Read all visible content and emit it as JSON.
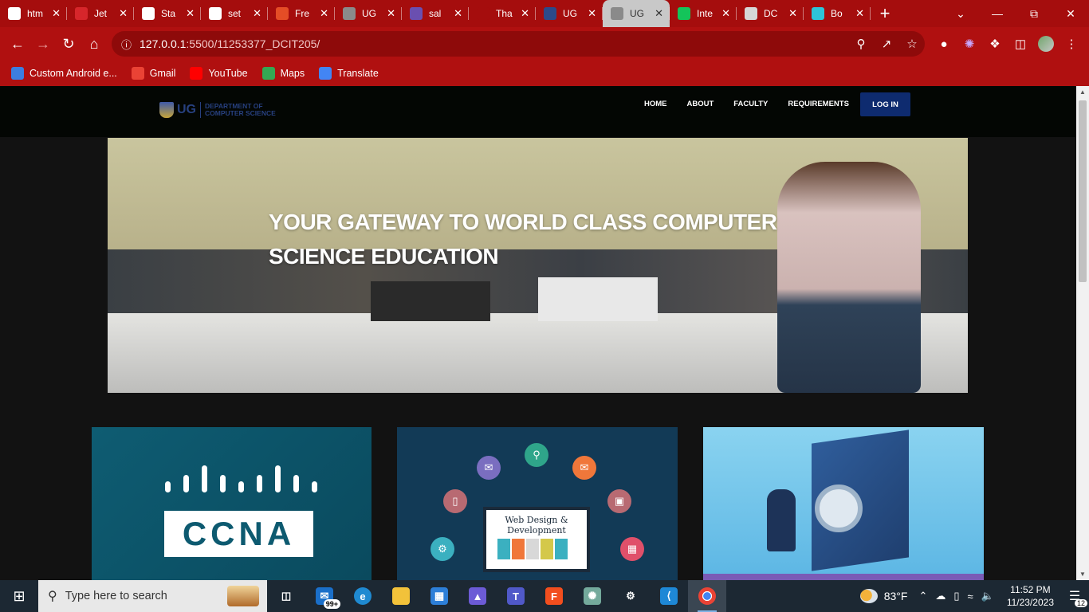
{
  "browser": {
    "tabs": [
      {
        "title": "htm",
        "favicon_color": "#ffffff",
        "icon": "google-icon"
      },
      {
        "title": "Jet",
        "favicon_color": "#d7262b",
        "icon": "swiss-icon"
      },
      {
        "title": "Sta",
        "favicon_color": "#ffffff",
        "icon": "github-icon"
      },
      {
        "title": "set",
        "favicon_color": "#ffffff",
        "icon": "google-icon"
      },
      {
        "title": "Fre",
        "favicon_color": "#e44d26",
        "icon": "html5-icon"
      },
      {
        "title": "UG",
        "favicon_color": "#8a8a8a",
        "icon": "globe-icon"
      },
      {
        "title": "sal",
        "favicon_color": "#6a4fb0",
        "icon": "crest-icon"
      },
      {
        "title": "Tha",
        "favicon_color": "#a50d0d",
        "icon": "blank-icon"
      },
      {
        "title": "UG",
        "favicon_color": "#2c4a8a",
        "icon": "ug-logo-icon"
      },
      {
        "title": "UG",
        "favicon_color": "#8a8a8a",
        "icon": "globe-icon",
        "active": true
      },
      {
        "title": "Inte",
        "favicon_color": "#14c45a",
        "icon": "play-icon"
      },
      {
        "title": "DC",
        "favicon_color": "#d6d6d6",
        "icon": "circle-icon"
      },
      {
        "title": "Bo",
        "favicon_color": "#2ec4d8",
        "icon": "cube-icon"
      }
    ],
    "new_tab_label": "+",
    "url_host": "127.0.0.1",
    "url_path": ":5500/11253377_DCIT205/",
    "bookmarks": [
      {
        "label": "Custom Android e...",
        "color": "#3d7ee0"
      },
      {
        "label": "Gmail",
        "color": "#ea4335"
      },
      {
        "label": "YouTube",
        "color": "#ff0000"
      },
      {
        "label": "Maps",
        "color": "#34a853"
      },
      {
        "label": "Translate",
        "color": "#4285f4"
      }
    ]
  },
  "site": {
    "logo_ug": "UG",
    "logo_dept": "DEPARTMENT OF COMPUTER SCIENCE",
    "nav": [
      "HOME",
      "ABOUT",
      "FACULTY",
      "REQUIREMENTS"
    ],
    "login_label": "LOG IN",
    "hero_title": "YOUR GATEWAY TO WORLD CLASS COMPUTER SCIENCE EDUCATION",
    "cards": [
      {
        "label": "CCNA",
        "bg": "#0e5c72"
      },
      {
        "label": "Web Design & Development",
        "bg": "#123a56"
      },
      {
        "label": "",
        "bg": "#7cc8ec"
      }
    ]
  },
  "taskbar": {
    "search_placeholder": "Type here to search",
    "mail_badge": "99+",
    "weather": "83°F",
    "time": "11:52 PM",
    "date": "11/23/2023",
    "notification_count": "12"
  }
}
